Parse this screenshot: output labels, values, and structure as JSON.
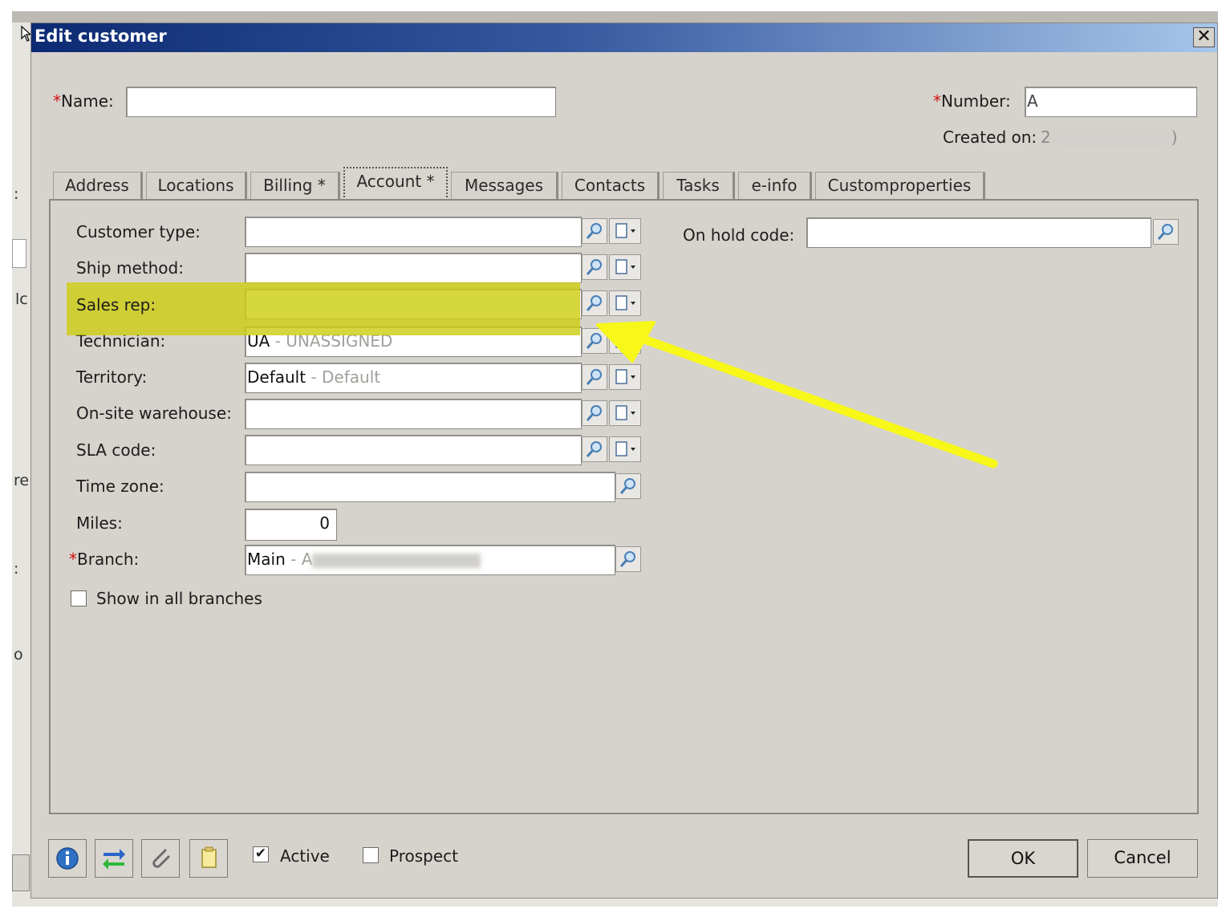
{
  "window": {
    "title": "Edit customer",
    "close_glyph": "✕"
  },
  "background_fragments": [
    ":",
    "lc",
    "re",
    ":",
    "o"
  ],
  "header": {
    "name_label": "Name:",
    "name_required": "*",
    "name_value": "",
    "number_label": "Number:",
    "number_required": "*",
    "number_value": "A",
    "created_on_label": "Created on:",
    "created_on_value": "2",
    "created_on_suffix": ")"
  },
  "tabs": [
    {
      "label": "Address"
    },
    {
      "label": "Locations"
    },
    {
      "label": "Billing  *"
    },
    {
      "label": "Account *",
      "active": true
    },
    {
      "label": "Messages"
    },
    {
      "label": "Contacts"
    },
    {
      "label": "Tasks"
    },
    {
      "label": "e-info"
    },
    {
      "label": "Customproperties"
    }
  ],
  "account": {
    "customer_type": {
      "label": "Customer type:",
      "value": ""
    },
    "ship_method": {
      "label": "Ship method:",
      "value": ""
    },
    "sales_rep": {
      "label": "Sales rep:",
      "value": ""
    },
    "technician": {
      "label": "Technician:",
      "code": "UA",
      "sep": " - ",
      "desc": "UNASSIGNED"
    },
    "territory": {
      "label": "Territory:",
      "code": "Default",
      "sep": " - ",
      "desc": "Default"
    },
    "onsite_warehouse": {
      "label": "On-site warehouse:",
      "value": ""
    },
    "sla_code": {
      "label": "SLA code:",
      "value": ""
    },
    "time_zone": {
      "label": "Time zone:",
      "value": ""
    },
    "miles": {
      "label": "Miles:",
      "value": "0"
    },
    "branch": {
      "label": "Branch:",
      "required": "*",
      "code": "Main",
      "sep": " - ",
      "desc": "A"
    },
    "show_all_branches": {
      "label": "Show in all branches",
      "checked": false
    },
    "on_hold_code": {
      "label": "On hold code:",
      "value": ""
    }
  },
  "footer": {
    "active": {
      "label": "Active",
      "checked": true
    },
    "prospect": {
      "label": "Prospect",
      "checked": false
    },
    "ok_label": "OK",
    "cancel_label": "Cancel",
    "toolbar_icons": [
      "info-icon",
      "sync-arrows-icon",
      "attachment-icon",
      "copy-document-icon"
    ]
  },
  "annotation": {
    "highlight_color": "#cccc14",
    "arrow_color": "#f7f71a"
  },
  "colors": {
    "title_bar_start": "#0c2a73",
    "title_bar_end": "#a8c6ea",
    "dialog_bg": "#d6d3cd",
    "required_mark": "#d01010"
  }
}
